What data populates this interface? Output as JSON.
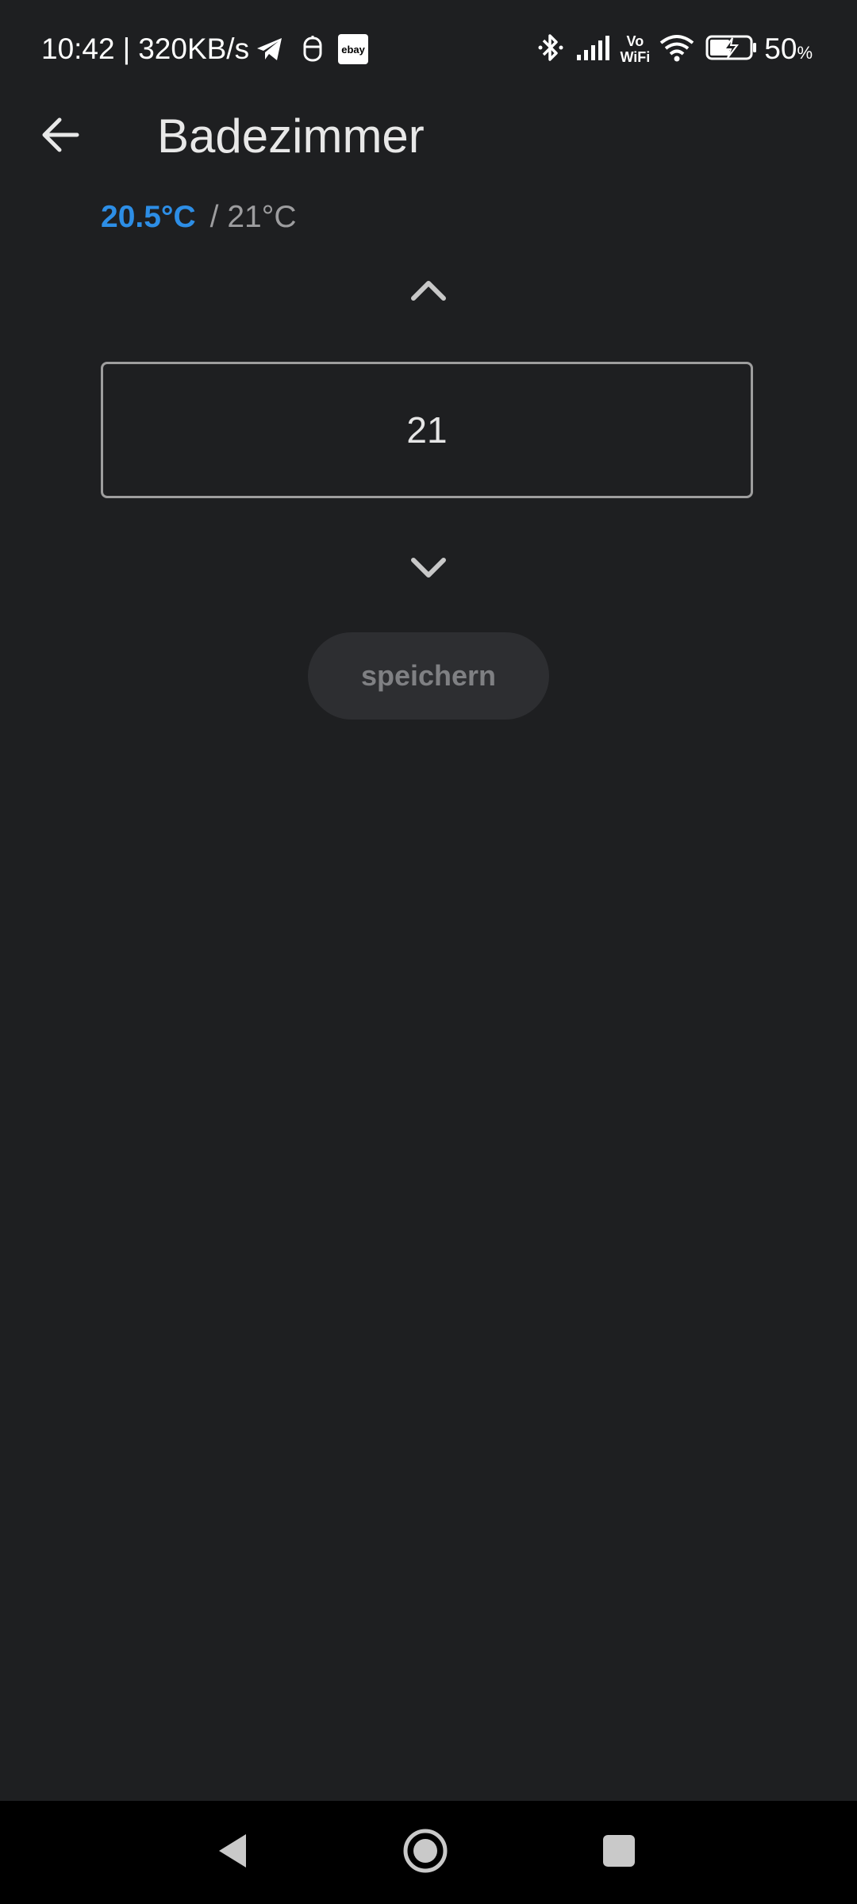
{
  "status_bar": {
    "time": "10:42",
    "separator": "|",
    "network_speed": "320KB/s",
    "ebay_label": "ebay",
    "vowifi_top": "Vo",
    "vowifi_bottom": "WiFi",
    "battery_percent": "50",
    "battery_unit": "%"
  },
  "header": {
    "title": "Badezimmer",
    "back_icon": "arrow-left-icon"
  },
  "temperature": {
    "current": "20.5°C",
    "target": "/ 21°C",
    "current_color": "#2d8ee6"
  },
  "stepper": {
    "value": "21",
    "up_icon": "chevron-up-icon",
    "down_icon": "chevron-down-icon"
  },
  "save_button": {
    "label": "speichern"
  },
  "nav_bar": {
    "back_icon": "triangle-back-icon",
    "home_icon": "circle-home-icon",
    "recents_icon": "square-recents-icon"
  }
}
